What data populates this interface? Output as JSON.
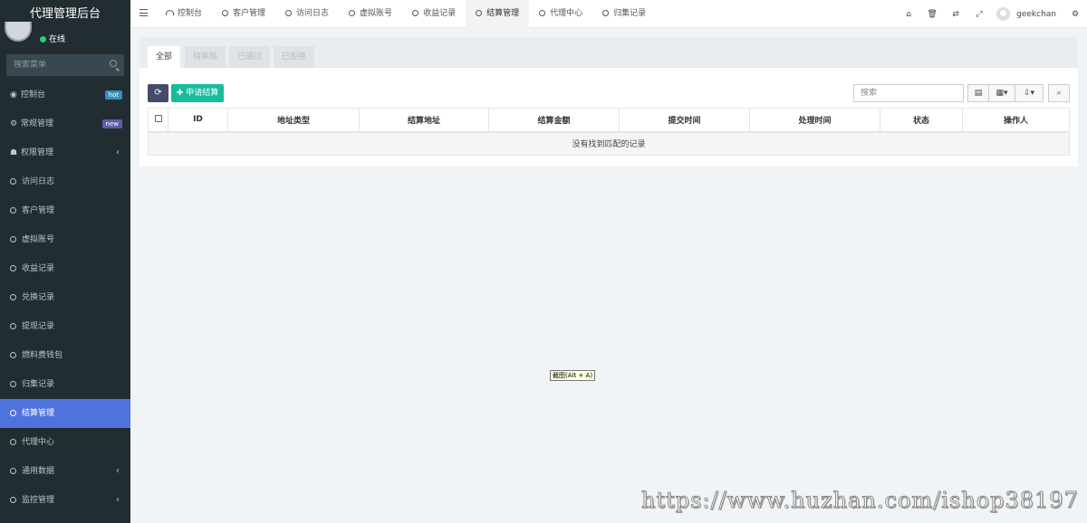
{
  "sidebar": {
    "brand": "代理管理后台",
    "status": "在线",
    "search_placeholder": "搜索菜单",
    "items": [
      {
        "label": "控制台",
        "badge": "hot"
      },
      {
        "label": "常规管理",
        "badge": "new"
      },
      {
        "label": "权限管理"
      },
      {
        "label": "访问日志"
      },
      {
        "label": "客户管理"
      },
      {
        "label": "虚拟账号"
      },
      {
        "label": "收益记录"
      },
      {
        "label": "兑换记录"
      },
      {
        "label": "提现记录"
      },
      {
        "label": "燃料费钱包"
      },
      {
        "label": "归集记录"
      },
      {
        "label": "结算管理"
      },
      {
        "label": "代理中心"
      },
      {
        "label": "通用数据"
      },
      {
        "label": "监控管理"
      }
    ]
  },
  "header": {
    "tabs": [
      "控制台",
      "客户管理",
      "访问日志",
      "虚拟账号",
      "收益记录",
      "结算管理",
      "代理中心",
      "归集记录"
    ],
    "username": "geekchan"
  },
  "content": {
    "tabs": [
      "全部",
      "待审核",
      "已通过",
      "已拒绝"
    ],
    "apply_button": "申请结算",
    "search_placeholder": "搜索",
    "columns": [
      "ID",
      "地址类型",
      "结算地址",
      "结算金额",
      "提交时间",
      "处理时间",
      "状态",
      "操作人"
    ],
    "empty_text": "没有找到匹配的记录"
  },
  "tooltip": "截图(Alt + A)",
  "watermark": "https://www.huzhan.com/ishop38197",
  "colors": {
    "sidebar_bg": "#222d32",
    "active_menu": "#4e73df",
    "apply_button": "#18bc9c",
    "refresh_button": "#444c6c",
    "badge_hot": "#3c8dbc",
    "badge_new": "#605ca8"
  }
}
